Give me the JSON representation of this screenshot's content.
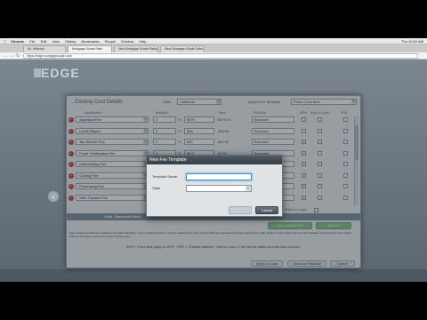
{
  "menubar": {
    "app": "Chrome",
    "items": [
      "File",
      "Edit",
      "View",
      "History",
      "Bookmarks",
      "People",
      "Window",
      "Help"
    ],
    "clock": "Thu 10:00 AM"
  },
  "tabs": [
    "Mr. Webinar",
    "Mortgage Grade Rate",
    "New Mortgage Grade Rates",
    "New Mortgage Grade Rates"
  ],
  "url": "https://edge.mortgagecoach.com",
  "app": {
    "logo": "EDGE"
  },
  "panel": {
    "title": "Closing Cost Details",
    "state_label": "State",
    "state_value": "California",
    "apply_label": "Apply from Template",
    "apply_value": "Primo Conv fees",
    "columns": [
      "Description",
      "Method",
      "Total",
      "Paid By",
      "APR",
      "Add to Loan",
      "FPE"
    ],
    "fees": [
      {
        "name": "Appraisal Fee",
        "method": "0",
        "amount": "$475",
        "total": "$475.00",
        "paid_by": "Borrower",
        "apr": false,
        "add": false,
        "fpe": false
      },
      {
        "name": "Credit Report",
        "method": "0",
        "amount": "$38",
        "total": "$38.00",
        "paid_by": "Borrower",
        "apr": false,
        "add": false,
        "fpe": false
      },
      {
        "name": "Tax Service Fee",
        "method": "0",
        "amount": "$90",
        "total": "$90.00",
        "paid_by": "Borrower",
        "apr": true,
        "add": false,
        "fpe": false
      },
      {
        "name": "Flood Certification Fee",
        "method": "0",
        "amount": "$8.5",
        "total": "$8.50",
        "paid_by": "Borrower",
        "apr": true,
        "add": false,
        "fpe": false
      },
      {
        "name": "Underwriting Fee",
        "method": "0",
        "amount": "",
        "total": "",
        "paid_by": "Borrower",
        "apr": true,
        "add": false,
        "fpe": false
      },
      {
        "name": "Closing Fee",
        "method": "0",
        "amount": "",
        "total": "",
        "paid_by": "Borrower",
        "apr": true,
        "add": false,
        "fpe": false
      },
      {
        "name": "Processing Fee",
        "method": "0",
        "amount": "",
        "total": "",
        "paid_by": "Borrower",
        "apr": true,
        "add": false,
        "fpe": false
      },
      {
        "name": "Wire Transfer Fee",
        "method": "0",
        "amount": "",
        "total": "",
        "paid_by": "Borrower",
        "apr": true,
        "add": false,
        "fpe": false
      }
    ],
    "prior_label": "Prior to Loan",
    "total_label": "Total - Borrower Fees",
    "add_custom_fee": "Add Custom Fee",
    "add_fee": "Add Fee",
    "notes": "Fees marked as APR are included in the APR calculation. Fees marked as Add to Loan are added to the loan amount. FPE fees are finance charges paid by the seller, lender or third parties and are not included in the borrower's fees. Press Save as Template to store these fees for future use.",
    "legend": "APR = Fees that apply to APR · FPE = Prepaid Interest · Add to Loan = Fee will be added to total loan amount.",
    "buttons": {
      "apply": "Apply to Loan",
      "save_template": "Save as Template",
      "cancel": "Cancel"
    }
  },
  "dialog": {
    "title": "New Fee Template",
    "name_label": "Template Name:",
    "name_value": "",
    "state_label": "State",
    "state_value": "",
    "save": "Save",
    "cancel": "Cancel"
  }
}
